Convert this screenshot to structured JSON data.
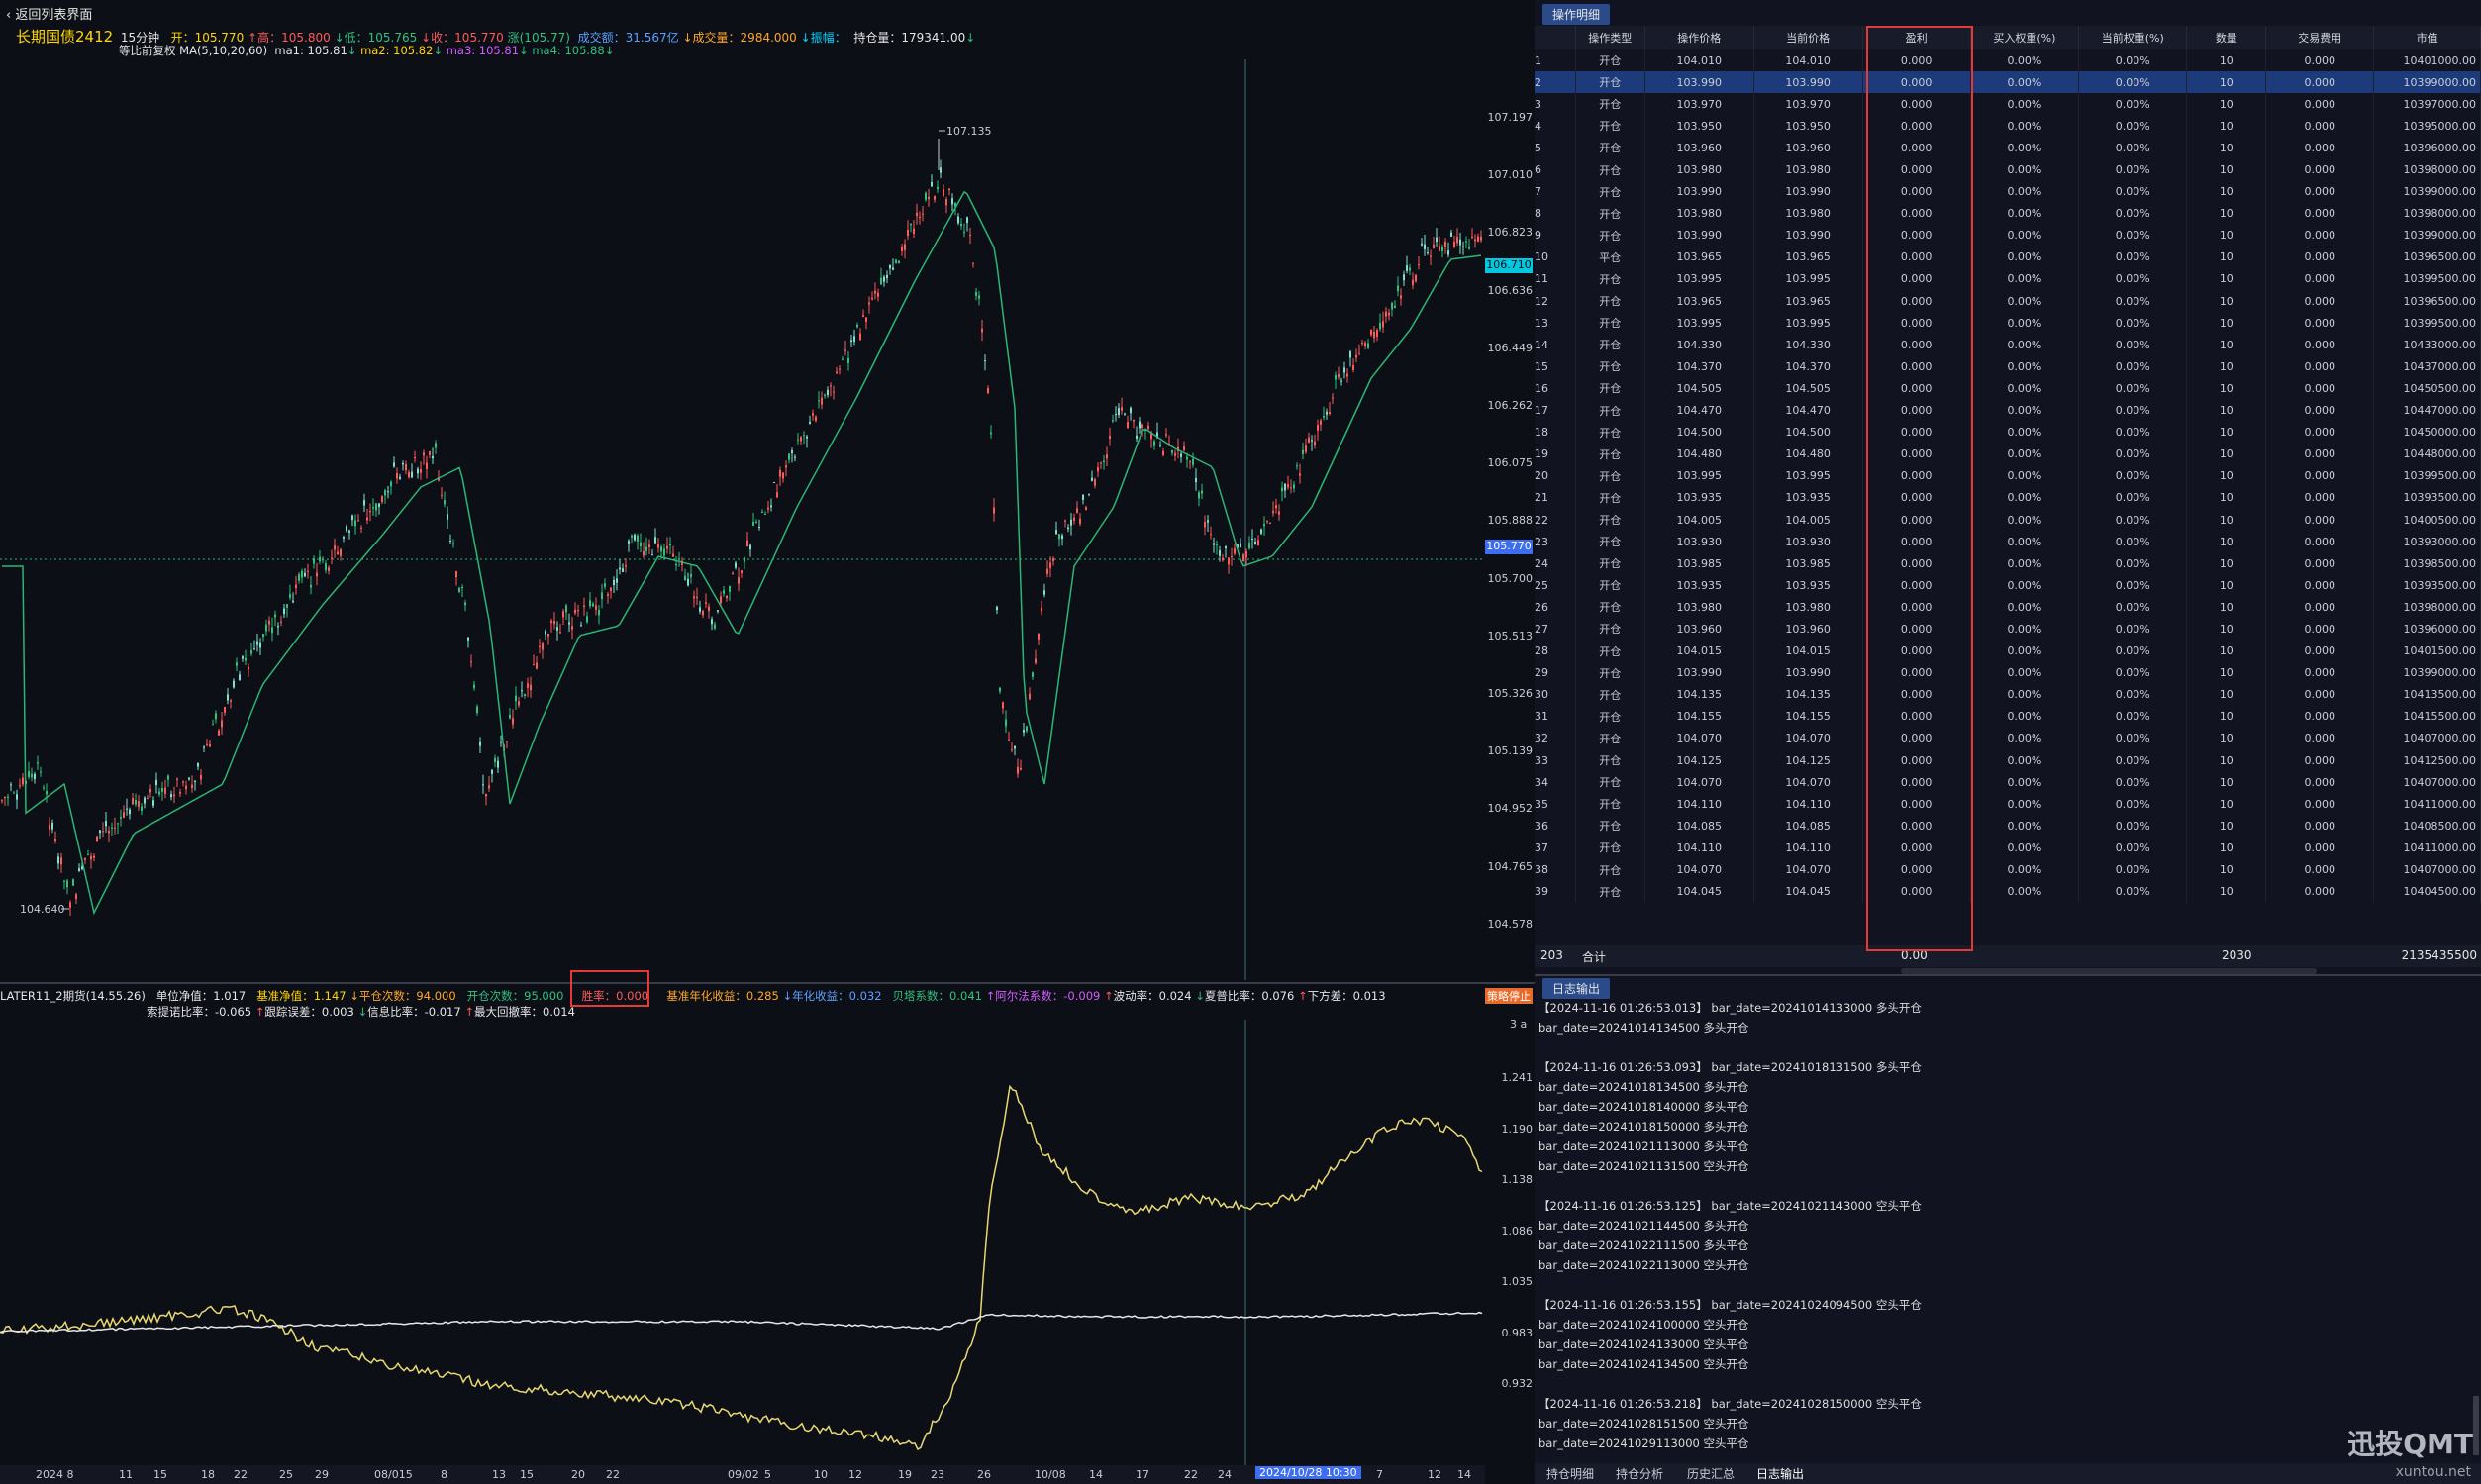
{
  "header": {
    "back_label": "‹ 返回列表界面",
    "instrument": "长期国债2412",
    "period": "15分钟",
    "open_label": "开：",
    "open": "105.770",
    "high_label": "高：",
    "high": "105.800",
    "low_label": "低：",
    "low": "105.765",
    "close_label": "收：",
    "close": "105.770",
    "change": "涨(105.77)",
    "turnover_label": "成交额：",
    "turnover": "31.567亿",
    "volume_label": "成交量：",
    "volume": "2984.000",
    "amplitude_label": "振幅：",
    "oi_label": "持仓量：",
    "oi": "179341.00",
    "adjust": "等比前复权",
    "ma_params": "MA(5,10,20,60)",
    "ma1": "ma1: 105.81",
    "ma2": "ma2: 105.82",
    "ma3": "ma3: 105.81",
    "ma4": "ma4: 105.88"
  },
  "main_axis": [
    "107.197",
    "107.010",
    "106.823",
    "106.636",
    "106.449",
    "106.262",
    "106.075",
    "105.888",
    "105.700",
    "105.513",
    "105.326",
    "105.139",
    "104.952",
    "104.765",
    "104.578"
  ],
  "price_tags": {
    "current": "106.710",
    "crosshair": "105.770",
    "peak": "107.135",
    "trough": "104.640"
  },
  "stats": {
    "strategy": "LATER11_2期货(14.55.26)",
    "nav_label": "单位净值：",
    "nav": "1.017",
    "bench_label": "基准净值：",
    "bench": "1.147",
    "close_count_label": "平仓次数：",
    "close_count": "94.000",
    "open_count_label": "开仓次数：",
    "open_count": "95.000",
    "winrate_label": "胜率：",
    "winrate": "0.000",
    "bench_annual_label": "基准年化收益：",
    "bench_annual": "0.285",
    "annual_label": "年化收益：",
    "annual": "0.032",
    "beta_label": "贝塔系数：",
    "beta": "0.041",
    "alpha_label": "阿尔法系数：",
    "alpha": "-0.009",
    "vol_label": "波动率：",
    "vol": "0.024",
    "sharpe_label": "夏普比率：",
    "sharpe": "0.076",
    "down_label": "下方差：",
    "down": "0.013",
    "sortino_label": "索提诺比率：",
    "sortino": "-0.065",
    "te_label": "跟踪误差：",
    "te": "0.003",
    "ir_label": "信息比率：",
    "ir": "-0.017",
    "mdd_label": "最大回撤率：",
    "mdd": "0.014",
    "stop_btn": "策略停止"
  },
  "sub_axis": [
    "1.241",
    "1.190",
    "1.138",
    "1.086",
    "1.035",
    "0.983",
    "0.932"
  ],
  "sub_note": "3 a",
  "x_axis": [
    "2024 8",
    "11",
    "15",
    "18",
    "22",
    "25",
    "29",
    "08/015",
    "8",
    "13",
    "15",
    "20",
    "22",
    "09/02",
    "5",
    "10",
    "12",
    "19",
    "23",
    "26",
    "10/08",
    "14",
    "17",
    "22",
    "24",
    "2024/10/28 10:30",
    "7",
    "12",
    "14"
  ],
  "right_panel": {
    "tab_ops": "操作明细",
    "columns": [
      "",
      "操作类型",
      "操作价格",
      "当前价格",
      "盈利",
      "买入权重(%)",
      "当前权重(%)",
      "数量",
      "交易费用",
      "市值"
    ],
    "rows": [
      [
        "1",
        "开仓",
        "104.010",
        "104.010",
        "0.000",
        "0.00%",
        "0.00%",
        "10",
        "0.000",
        "10401000.00"
      ],
      [
        "2",
        "开仓",
        "103.990",
        "103.990",
        "0.000",
        "0.00%",
        "0.00%",
        "10",
        "0.000",
        "10399000.00"
      ],
      [
        "3",
        "开仓",
        "103.970",
        "103.970",
        "0.000",
        "0.00%",
        "0.00%",
        "10",
        "0.000",
        "10397000.00"
      ],
      [
        "4",
        "开仓",
        "103.950",
        "103.950",
        "0.000",
        "0.00%",
        "0.00%",
        "10",
        "0.000",
        "10395000.00"
      ],
      [
        "5",
        "开仓",
        "103.960",
        "103.960",
        "0.000",
        "0.00%",
        "0.00%",
        "10",
        "0.000",
        "10396000.00"
      ],
      [
        "6",
        "开仓",
        "103.980",
        "103.980",
        "0.000",
        "0.00%",
        "0.00%",
        "10",
        "0.000",
        "10398000.00"
      ],
      [
        "7",
        "开仓",
        "103.990",
        "103.990",
        "0.000",
        "0.00%",
        "0.00%",
        "10",
        "0.000",
        "10399000.00"
      ],
      [
        "8",
        "开仓",
        "103.980",
        "103.980",
        "0.000",
        "0.00%",
        "0.00%",
        "10",
        "0.000",
        "10398000.00"
      ],
      [
        "9",
        "开仓",
        "103.990",
        "103.990",
        "0.000",
        "0.00%",
        "0.00%",
        "10",
        "0.000",
        "10399000.00"
      ],
      [
        "10",
        "平仓",
        "103.965",
        "103.965",
        "0.000",
        "0.00%",
        "0.00%",
        "10",
        "0.000",
        "10396500.00"
      ],
      [
        "11",
        "开仓",
        "103.995",
        "103.995",
        "0.000",
        "0.00%",
        "0.00%",
        "10",
        "0.000",
        "10399500.00"
      ],
      [
        "12",
        "开仓",
        "103.965",
        "103.965",
        "0.000",
        "0.00%",
        "0.00%",
        "10",
        "0.000",
        "10396500.00"
      ],
      [
        "13",
        "开仓",
        "103.995",
        "103.995",
        "0.000",
        "0.00%",
        "0.00%",
        "10",
        "0.000",
        "10399500.00"
      ],
      [
        "14",
        "开仓",
        "104.330",
        "104.330",
        "0.000",
        "0.00%",
        "0.00%",
        "10",
        "0.000",
        "10433000.00"
      ],
      [
        "15",
        "开仓",
        "104.370",
        "104.370",
        "0.000",
        "0.00%",
        "0.00%",
        "10",
        "0.000",
        "10437000.00"
      ],
      [
        "16",
        "开仓",
        "104.505",
        "104.505",
        "0.000",
        "0.00%",
        "0.00%",
        "10",
        "0.000",
        "10450500.00"
      ],
      [
        "17",
        "开仓",
        "104.470",
        "104.470",
        "0.000",
        "0.00%",
        "0.00%",
        "10",
        "0.000",
        "10447000.00"
      ],
      [
        "18",
        "开仓",
        "104.500",
        "104.500",
        "0.000",
        "0.00%",
        "0.00%",
        "10",
        "0.000",
        "10450000.00"
      ],
      [
        "19",
        "开仓",
        "104.480",
        "104.480",
        "0.000",
        "0.00%",
        "0.00%",
        "10",
        "0.000",
        "10448000.00"
      ],
      [
        "20",
        "开仓",
        "103.995",
        "103.995",
        "0.000",
        "0.00%",
        "0.00%",
        "10",
        "0.000",
        "10399500.00"
      ],
      [
        "21",
        "开仓",
        "103.935",
        "103.935",
        "0.000",
        "0.00%",
        "0.00%",
        "10",
        "0.000",
        "10393500.00"
      ],
      [
        "22",
        "开仓",
        "104.005",
        "104.005",
        "0.000",
        "0.00%",
        "0.00%",
        "10",
        "0.000",
        "10400500.00"
      ],
      [
        "23",
        "开仓",
        "103.930",
        "103.930",
        "0.000",
        "0.00%",
        "0.00%",
        "10",
        "0.000",
        "10393000.00"
      ],
      [
        "24",
        "开仓",
        "103.985",
        "103.985",
        "0.000",
        "0.00%",
        "0.00%",
        "10",
        "0.000",
        "10398500.00"
      ],
      [
        "25",
        "开仓",
        "103.935",
        "103.935",
        "0.000",
        "0.00%",
        "0.00%",
        "10",
        "0.000",
        "10393500.00"
      ],
      [
        "26",
        "开仓",
        "103.980",
        "103.980",
        "0.000",
        "0.00%",
        "0.00%",
        "10",
        "0.000",
        "10398000.00"
      ],
      [
        "27",
        "开仓",
        "103.960",
        "103.960",
        "0.000",
        "0.00%",
        "0.00%",
        "10",
        "0.000",
        "10396000.00"
      ],
      [
        "28",
        "开仓",
        "104.015",
        "104.015",
        "0.000",
        "0.00%",
        "0.00%",
        "10",
        "0.000",
        "10401500.00"
      ],
      [
        "29",
        "开仓",
        "103.990",
        "103.990",
        "0.000",
        "0.00%",
        "0.00%",
        "10",
        "0.000",
        "10399000.00"
      ],
      [
        "30",
        "开仓",
        "104.135",
        "104.135",
        "0.000",
        "0.00%",
        "0.00%",
        "10",
        "0.000",
        "10413500.00"
      ],
      [
        "31",
        "开仓",
        "104.155",
        "104.155",
        "0.000",
        "0.00%",
        "0.00%",
        "10",
        "0.000",
        "10415500.00"
      ],
      [
        "32",
        "开仓",
        "104.070",
        "104.070",
        "0.000",
        "0.00%",
        "0.00%",
        "10",
        "0.000",
        "10407000.00"
      ],
      [
        "33",
        "开仓",
        "104.125",
        "104.125",
        "0.000",
        "0.00%",
        "0.00%",
        "10",
        "0.000",
        "10412500.00"
      ],
      [
        "34",
        "开仓",
        "104.070",
        "104.070",
        "0.000",
        "0.00%",
        "0.00%",
        "10",
        "0.000",
        "10407000.00"
      ],
      [
        "35",
        "开仓",
        "104.110",
        "104.110",
        "0.000",
        "0.00%",
        "0.00%",
        "10",
        "0.000",
        "10411000.00"
      ],
      [
        "36",
        "开仓",
        "104.085",
        "104.085",
        "0.000",
        "0.00%",
        "0.00%",
        "10",
        "0.000",
        "10408500.00"
      ],
      [
        "37",
        "开仓",
        "104.110",
        "104.110",
        "0.000",
        "0.00%",
        "0.00%",
        "10",
        "0.000",
        "10411000.00"
      ],
      [
        "38",
        "开仓",
        "104.070",
        "104.070",
        "0.000",
        "0.00%",
        "0.00%",
        "10",
        "0.000",
        "10407000.00"
      ],
      [
        "39",
        "开仓",
        "104.045",
        "104.045",
        "0.000",
        "0.00%",
        "0.00%",
        "10",
        "0.000",
        "10404500.00"
      ]
    ],
    "sum": {
      "count": "203",
      "label": "合计",
      "profit": "0.00",
      "qty": "2030",
      "value": "2135435500"
    },
    "tab_log": "日志输出",
    "log_lines": [
      "【2024-11-16 01:26:53.013】  bar_date=20241014133000 多头开仓",
      "bar_date=20241014134500 多头开仓",
      "",
      "【2024-11-16 01:26:53.093】  bar_date=20241018131500 多头平仓",
      "bar_date=20241018134500 多头开仓",
      "bar_date=20241018140000 多头平仓",
      "bar_date=20241018150000 多头开仓",
      "bar_date=20241021113000 多头平仓",
      "bar_date=20241021131500 空头开仓",
      "",
      "【2024-11-16 01:26:53.125】  bar_date=20241021143000 空头平仓",
      "bar_date=20241021144500 多头开仓",
      "bar_date=20241022111500 多头平仓",
      "bar_date=20241022113000 空头开仓",
      "",
      "【2024-11-16 01:26:53.155】  bar_date=20241024094500 空头平仓",
      "bar_date=20241024100000 空头开仓",
      "bar_date=20241024133000 空头平仓",
      "bar_date=20241024134500 空头开仓",
      "",
      "【2024-11-16 01:26:53.218】  bar_date=20241028150000 空头平仓",
      "bar_date=20241028151500 空头开仓",
      "bar_date=20241029113000 空头平仓"
    ],
    "bottom_tabs": [
      "持仓明细",
      "持仓分析",
      "历史汇总",
      "日志输出"
    ],
    "watermark": "迅投QMT",
    "watermark_url": "xuntou.net"
  },
  "colors": {
    "up": "#ff5a5a",
    "down": "#2ec27e",
    "ma_line": "#2bb673",
    "nav_line": "#e8d870",
    "bench_line": "#e6e6e6",
    "highlight": "#e53935"
  }
}
